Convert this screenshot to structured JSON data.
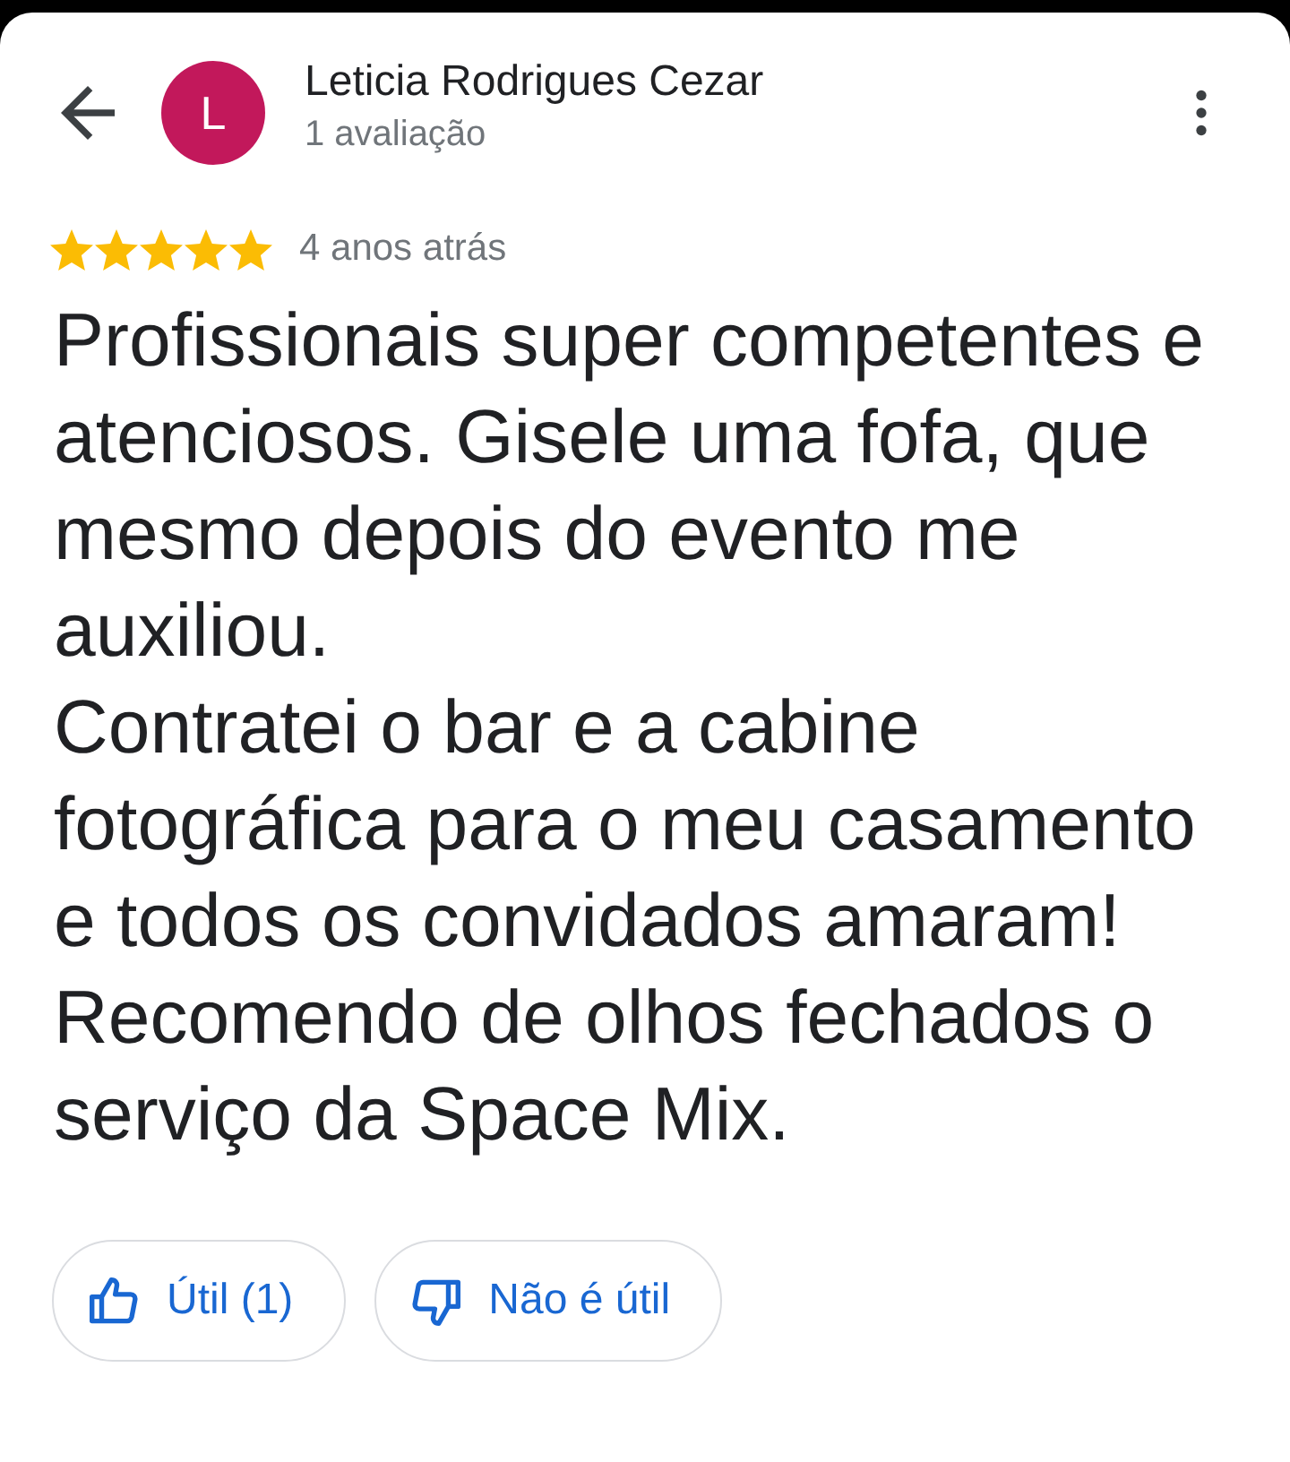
{
  "reviewer": {
    "initial": "L",
    "name": "Leticia Rodrigues Cezar",
    "subtitle": "1 avaliação"
  },
  "review": {
    "stars": 5,
    "time": "4 anos atrás",
    "paragraphs": [
      "Profissionais super competentes e atenciosos. Gisele uma fofa, que mesmo depois do evento me auxiliou.",
      "Contratei o bar e a cabine fotográfica para o meu casamento e todos os convidados amaram! Recomendo de olhos fechados o serviço da Space Mix."
    ]
  },
  "actions": [
    {
      "kind": "helpful",
      "label": "Útil (1)"
    },
    {
      "kind": "not_helpful",
      "label": "Não é útil"
    }
  ]
}
